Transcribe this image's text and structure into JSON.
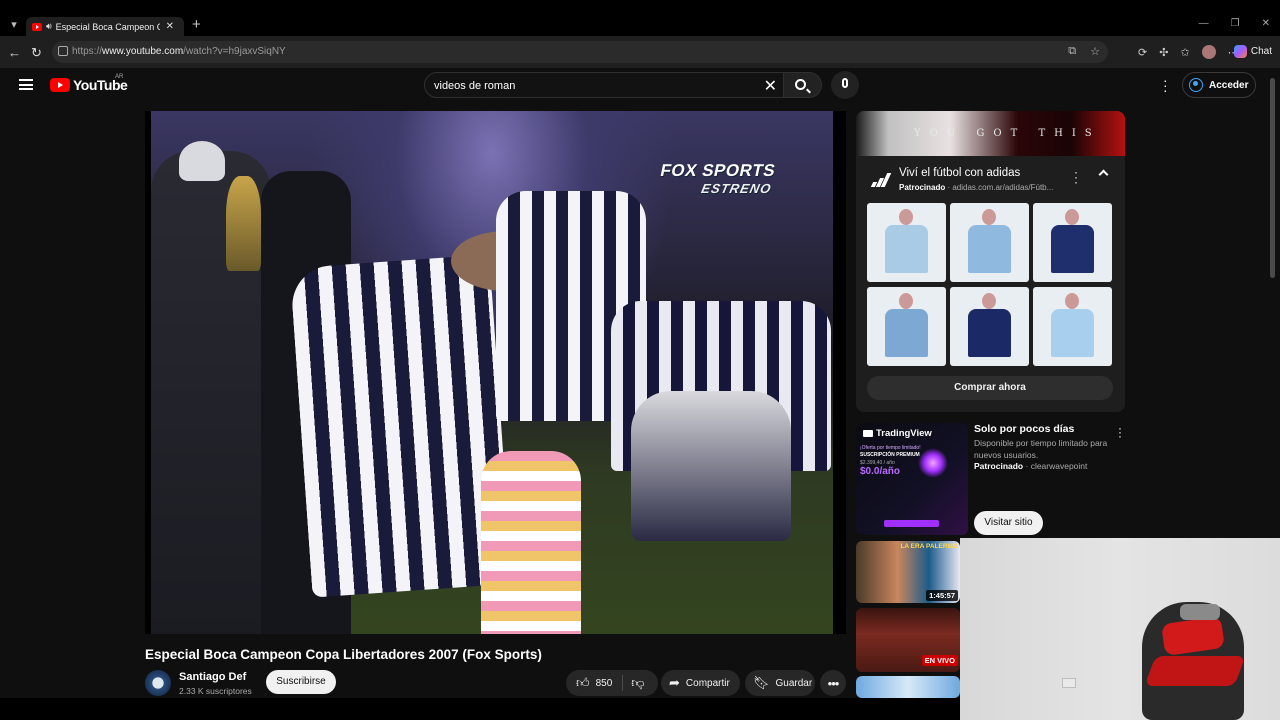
{
  "browser": {
    "tab_title": "Especial Boca Campeon Copa Libertadores 2007 (Fox Sports)",
    "url_prefix": "https://",
    "url_host": "www.youtube.com",
    "url_path": "/watch?v=h9jaxvSiqNY",
    "chat_label": "Chat"
  },
  "header": {
    "logo_text": "YouTube",
    "country_code": "AR",
    "search_query": "videos de roman",
    "signin_label": "Acceder"
  },
  "video": {
    "overlay_brand": "FOX SPORTS",
    "overlay_sub": "ESTRENO",
    "title": "Especial Boca Campeon Copa Libertadores 2007 (Fox Sports)",
    "channel_name": "Santiago Def",
    "channel_subscribers": "2.33 K suscriptores",
    "subscribe_label": "Suscribirse",
    "like_count": "850",
    "share_label": "Compartir",
    "save_label": "Guardar"
  },
  "ad_adidas": {
    "banner_text": "YOU GOT THIS",
    "title": "Viví el fútbol con adidas",
    "sponsored_label": "Patrocinado",
    "domain": "adidas.com.ar/adidas/Fútb...",
    "cta_label": "Comprar ahora",
    "shirt_colors": [
      "#a9cbe6",
      "#8fb9df",
      "#1f2f6e",
      "#7ea8d4",
      "#1b2a66",
      "#a8d0ee"
    ]
  },
  "ad_tradingview": {
    "brand": "TradingView",
    "promo_line1": "¡Oferta por tiempo limitado!",
    "promo_line2": "SUSCRIPCIÓN PREMIUM",
    "promo_old_price": "$2.399,40 / año",
    "promo_price": "$0.0/año",
    "title": "Solo por pocos días",
    "description": "Disponible por tiempo limitado para nuevos usuarios.",
    "sponsored_label": "Patrocinado",
    "advertiser": "clearwavepoint",
    "cta_label": "Visitar sitio"
  },
  "recommendations": [
    {
      "overlay": "LA ERA PALERMO",
      "duration": "1:45:57"
    },
    {
      "badge": "EN VIVO"
    },
    {}
  ],
  "colors": {
    "youtube_red": "#ff0000",
    "page_background": "#0f0f0f",
    "live_red": "#cc0000"
  }
}
